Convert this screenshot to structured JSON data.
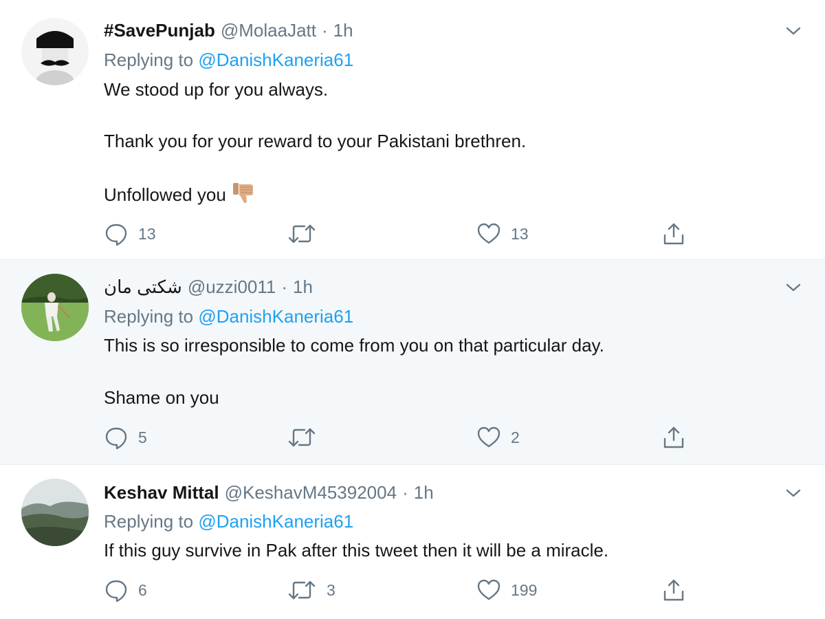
{
  "tweets": [
    {
      "display_name": "#SavePunjab",
      "handle": "@MolaaJatt",
      "separator": "·",
      "time": "1h",
      "replying_prefix": "Replying to",
      "replying_to": "@DanishKaneria61",
      "lines": [
        "We stood up for you always.",
        "Thank you for your reward to your Pakistani brethren.",
        "Unfollowed you"
      ],
      "emoji": "thumbs-down-icon",
      "replies": "13",
      "retweets": "",
      "likes": "13"
    },
    {
      "display_name": "شکتی مان",
      "handle": "@uzzi0011",
      "separator": "·",
      "time": "1h",
      "replying_prefix": "Replying to",
      "replying_to": "@DanishKaneria61",
      "lines": [
        "This is so irresponsible to come from you on that particular day.",
        "Shame on you"
      ],
      "replies": "5",
      "retweets": "",
      "likes": "2"
    },
    {
      "display_name": "Keshav Mittal",
      "handle": "@KeshavM45392004",
      "separator": "·",
      "time": "1h",
      "replying_prefix": "Replying to",
      "replying_to": "@DanishKaneria61",
      "lines": [
        "If this guy survive in Pak after this tweet then it will be a miracle."
      ],
      "replies": "6",
      "retweets": "3",
      "likes": "199"
    }
  ],
  "colors": {
    "link": "#1da1f2",
    "muted": "#657786",
    "text": "#14171a",
    "highlight_bg": "#f5f8fa",
    "divider": "#e6ecf0"
  },
  "icons": [
    "reply-icon",
    "retweet-icon",
    "like-icon",
    "share-icon",
    "chevron-down-icon",
    "thumbs-down-icon"
  ]
}
